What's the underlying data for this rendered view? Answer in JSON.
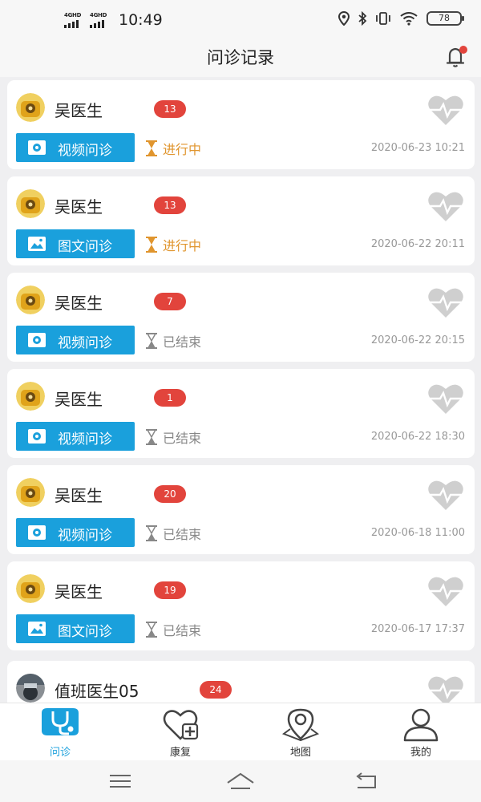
{
  "status_bar": {
    "signal1": "4GHD",
    "signal2": "4GHD",
    "time": "10:49",
    "battery": "78",
    "icons": [
      "location-icon",
      "bluetooth-icon",
      "vibrate-icon",
      "wifi-icon",
      "battery-icon"
    ]
  },
  "header": {
    "title": "问诊记录",
    "bell_icon": "bell-icon",
    "has_notification_dot": true
  },
  "consultations": [
    {
      "doctor": "吴医生",
      "count": "13",
      "type": "视频问诊",
      "type_icon": "video-icon",
      "status": "进行中",
      "state": "ongoing",
      "time": "2020-06-23 10:21",
      "avatar": "cartoon-avatar"
    },
    {
      "doctor": "吴医生",
      "count": "13",
      "type": "图文问诊",
      "type_icon": "image-icon",
      "status": "进行中",
      "state": "ongoing",
      "time": "2020-06-22 20:11",
      "avatar": "cartoon-avatar"
    },
    {
      "doctor": "吴医生",
      "count": "7",
      "type": "视频问诊",
      "type_icon": "video-icon",
      "status": "已结束",
      "state": "ended",
      "time": "2020-06-22 20:15",
      "avatar": "cartoon-avatar"
    },
    {
      "doctor": "吴医生",
      "count": "1",
      "type": "视频问诊",
      "type_icon": "video-icon",
      "status": "已结束",
      "state": "ended",
      "time": "2020-06-22 18:30",
      "avatar": "cartoon-avatar"
    },
    {
      "doctor": "吴医生",
      "count": "20",
      "type": "视频问诊",
      "type_icon": "video-icon",
      "status": "已结束",
      "state": "ended",
      "time": "2020-06-18 11:00",
      "avatar": "cartoon-avatar"
    },
    {
      "doctor": "吴医生",
      "count": "19",
      "type": "图文问诊",
      "type_icon": "image-icon",
      "status": "已结束",
      "state": "ended",
      "time": "2020-06-17 17:37",
      "avatar": "cartoon-avatar"
    },
    {
      "doctor": "值班医生05",
      "count": "24",
      "type": "",
      "type_icon": "",
      "status": "",
      "state": "",
      "time": "",
      "avatar": "photo-avatar"
    }
  ],
  "tabbar": {
    "tabs": [
      {
        "label": "问诊",
        "icon": "stethoscope-icon",
        "active": true
      },
      {
        "label": "康复",
        "icon": "heart-plus-icon",
        "active": false
      },
      {
        "label": "地图",
        "icon": "map-pin-icon",
        "active": false
      },
      {
        "label": "我的",
        "icon": "user-icon",
        "active": false
      }
    ]
  },
  "navbar": {
    "buttons": [
      "menu-icon",
      "home-icon",
      "back-icon"
    ]
  },
  "colors": {
    "accent": "#1aa0dc",
    "badge": "#e2443c",
    "ongoing": "#e0952e",
    "ended": "#888888",
    "background": "#efeff1"
  }
}
